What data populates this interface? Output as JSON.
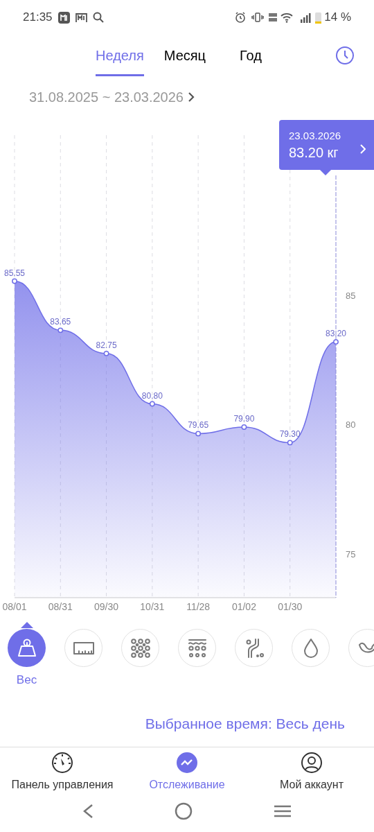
{
  "status_bar": {
    "time": "21:35",
    "battery": "14 %"
  },
  "tabs": [
    {
      "label": "Неделя",
      "selected": true
    },
    {
      "label": "Месяц",
      "selected": false
    },
    {
      "label": "Год",
      "selected": false
    }
  ],
  "date_range": "31.08.2025 ~ 23.03.2026",
  "tooltip": {
    "date": "23.03.2026",
    "value": "83.20 кг"
  },
  "chart": {
    "chart_data": {
      "type": "area",
      "categories": [
        "08/01",
        "08/31",
        "09/30",
        "10/31",
        "11/28",
        "01/02",
        "01/30",
        null
      ],
      "yticks": [
        75,
        80,
        85
      ],
      "ylim": [
        73.3,
        91.2
      ],
      "series": [
        {
          "color": "#6f6ee8",
          "values": [
            85.55,
            83.65,
            82.75,
            80.8,
            79.65,
            79.9,
            79.3,
            83.2
          ]
        }
      ],
      "grid": true,
      "value_labels": [
        "85.55",
        "83.65",
        "82.75",
        "80.80",
        "79.65",
        "79.90",
        "79.30",
        "83.20"
      ]
    }
  },
  "metrics": [
    {
      "label": "Вес",
      "selected": true
    },
    {
      "selected": false
    },
    {
      "selected": false
    },
    {
      "selected": false
    },
    {
      "selected": false
    },
    {
      "selected": false
    },
    {
      "selected": false
    }
  ],
  "selected_time": "Выбранное время: Весь день",
  "bottom_nav": [
    {
      "label": "Панель управления",
      "selected": false
    },
    {
      "label": "Отслеживание",
      "selected": true
    },
    {
      "label": "Мой аккаунт",
      "selected": false
    }
  ]
}
